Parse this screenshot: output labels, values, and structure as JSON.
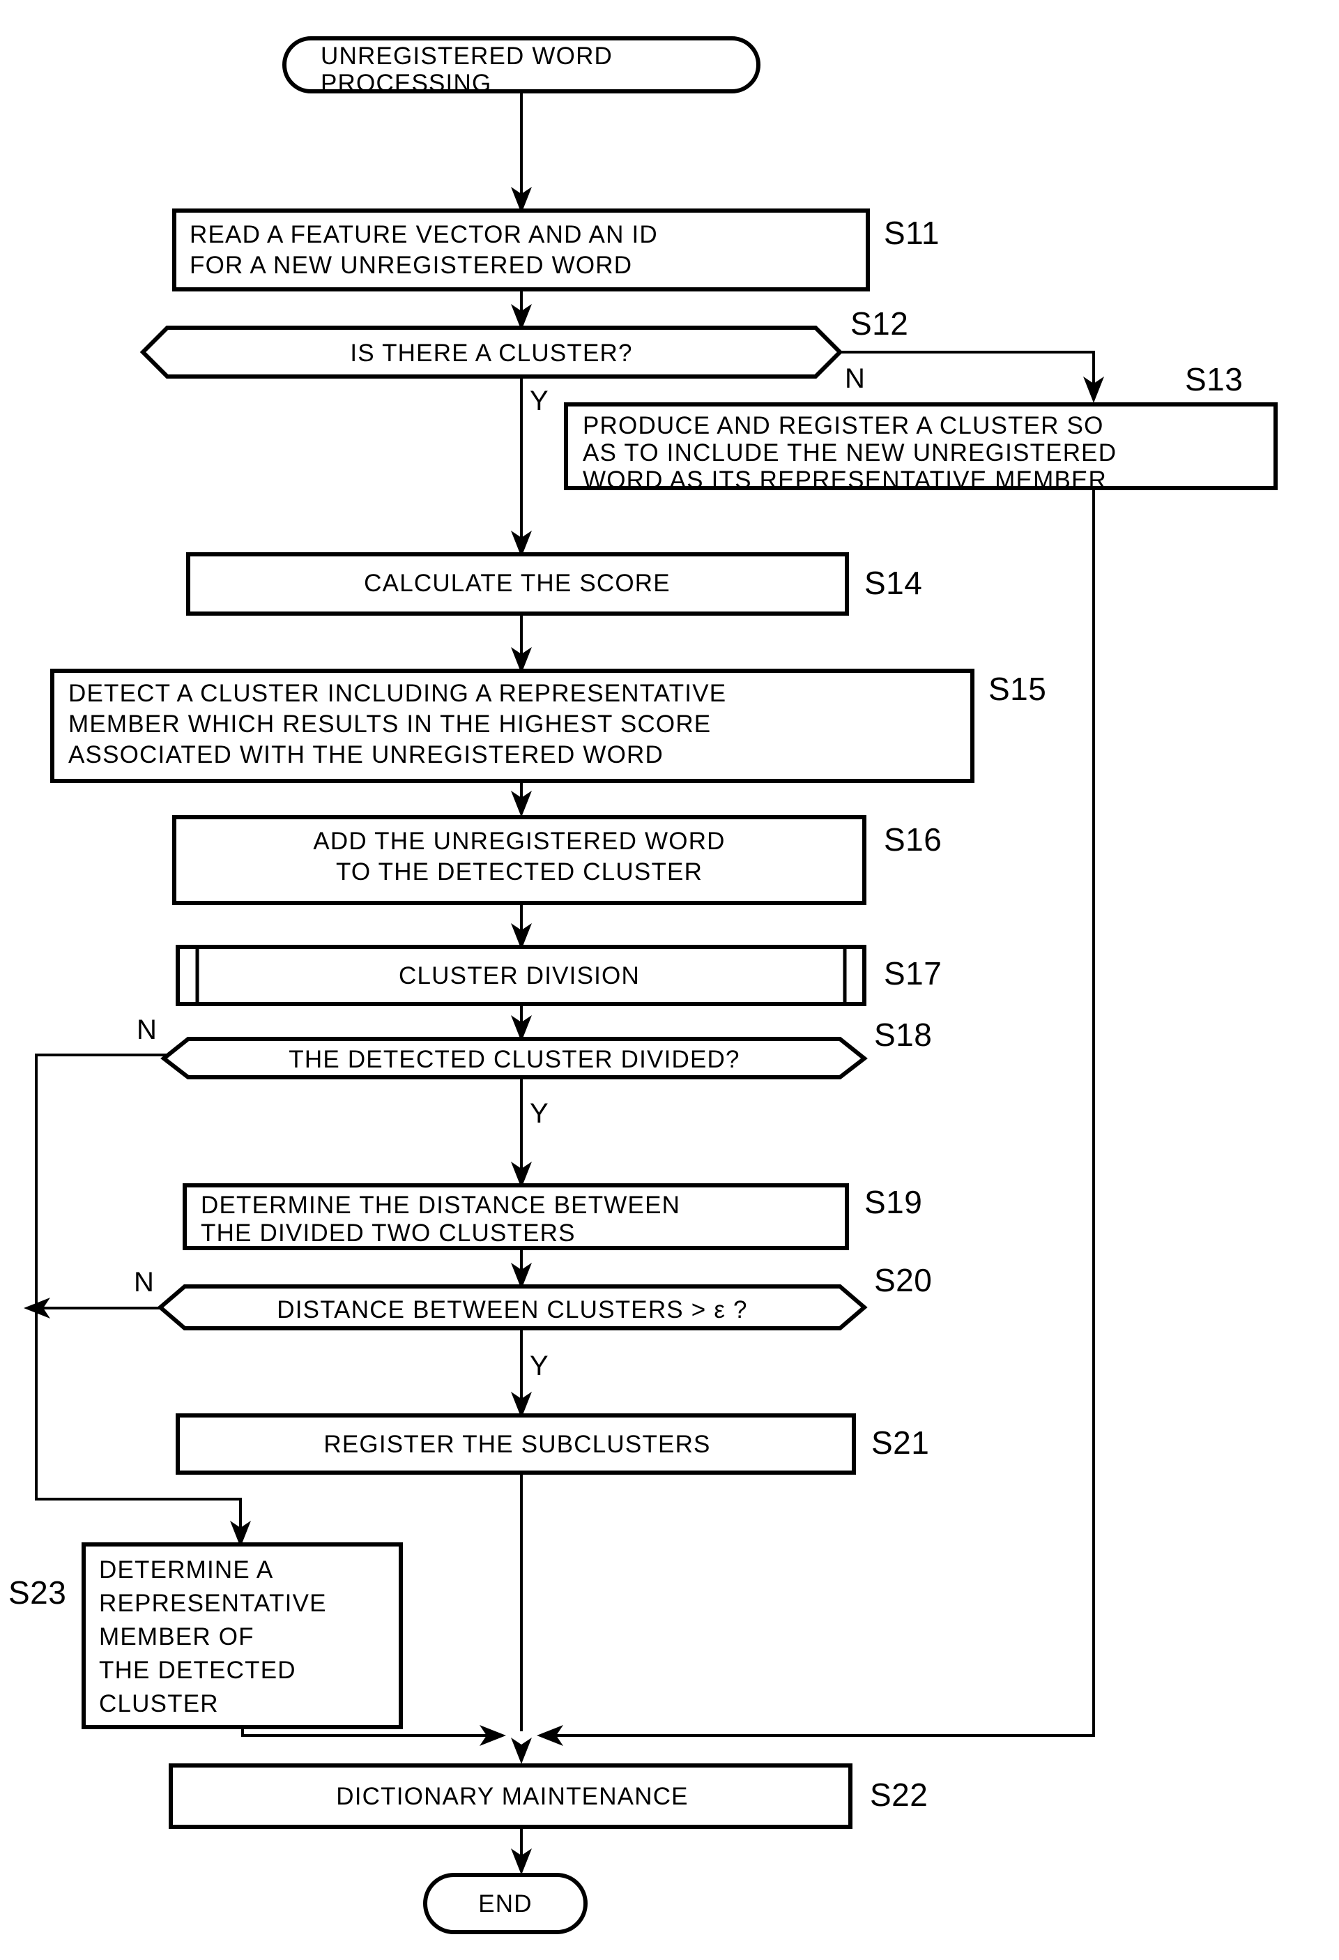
{
  "diagram": {
    "title": "UNREGISTERED WORD PROCESSING",
    "type": "flowchart",
    "terminals": {
      "start_line1": "UNREGISTERED WORD",
      "start_line2": "PROCESSING",
      "end": "END"
    },
    "steps": [
      {
        "id": "S11",
        "label": "S11",
        "shape": "process",
        "lines": [
          "READ A FEATURE VECTOR AND AN ID",
          "FOR A NEW UNREGISTERED WORD"
        ],
        "align": "left"
      },
      {
        "id": "S12",
        "label": "S12",
        "shape": "decision",
        "lines": [
          "IS THERE A CLUSTER?"
        ],
        "align": "center",
        "branch_yes": "Y",
        "branch_no": "N"
      },
      {
        "id": "S13",
        "label": "S13",
        "shape": "process",
        "lines": [
          "PRODUCE AND REGISTER A CLUSTER SO",
          "AS TO INCLUDE THE NEW UNREGISTERED",
          "WORD AS ITS REPRESENTATIVE MEMBER"
        ],
        "align": "left"
      },
      {
        "id": "S14",
        "label": "S14",
        "shape": "process",
        "lines": [
          "CALCULATE THE SCORE"
        ],
        "align": "center"
      },
      {
        "id": "S15",
        "label": "S15",
        "shape": "process",
        "lines": [
          "DETECT A CLUSTER INCLUDING A REPRESENTATIVE",
          "MEMBER WHICH RESULTS IN THE HIGHEST SCORE",
          "ASSOCIATED WITH THE UNREGISTERED WORD"
        ],
        "align": "left"
      },
      {
        "id": "S16",
        "label": "S16",
        "shape": "process",
        "lines": [
          "ADD THE UNREGISTERED WORD",
          "TO THE DETECTED CLUSTER"
        ],
        "align": "center"
      },
      {
        "id": "S17",
        "label": "S17",
        "shape": "predefined-process",
        "lines": [
          "CLUSTER DIVISION"
        ],
        "align": "center"
      },
      {
        "id": "S18",
        "label": "S18",
        "shape": "decision",
        "lines": [
          "THE DETECTED CLUSTER DIVIDED?"
        ],
        "align": "center",
        "branch_yes": "Y",
        "branch_no": "N"
      },
      {
        "id": "S19",
        "label": "S19",
        "shape": "process",
        "lines": [
          "DETERMINE THE DISTANCE BETWEEN",
          "THE DIVIDED TWO CLUSTERS"
        ],
        "align": "left"
      },
      {
        "id": "S20",
        "label": "S20",
        "shape": "decision",
        "lines": [
          "DISTANCE BETWEEN CLUSTERS > ε ?"
        ],
        "align": "center",
        "branch_yes": "Y",
        "branch_no": "N"
      },
      {
        "id": "S21",
        "label": "S21",
        "shape": "process",
        "lines": [
          "REGISTER THE SUBCLUSTERS"
        ],
        "align": "center"
      },
      {
        "id": "S23",
        "label": "S23",
        "shape": "process",
        "lines": [
          "DETERMINE A",
          "REPRESENTATIVE",
          "MEMBER OF",
          "THE DETECTED",
          "CLUSTER"
        ],
        "align": "left"
      },
      {
        "id": "S22",
        "label": "S22",
        "shape": "process",
        "lines": [
          "DICTIONARY MAINTENANCE"
        ],
        "align": "center"
      }
    ],
    "colors": {
      "stroke": "#000000",
      "fill": "#ffffff",
      "background": "#ffffff"
    }
  }
}
